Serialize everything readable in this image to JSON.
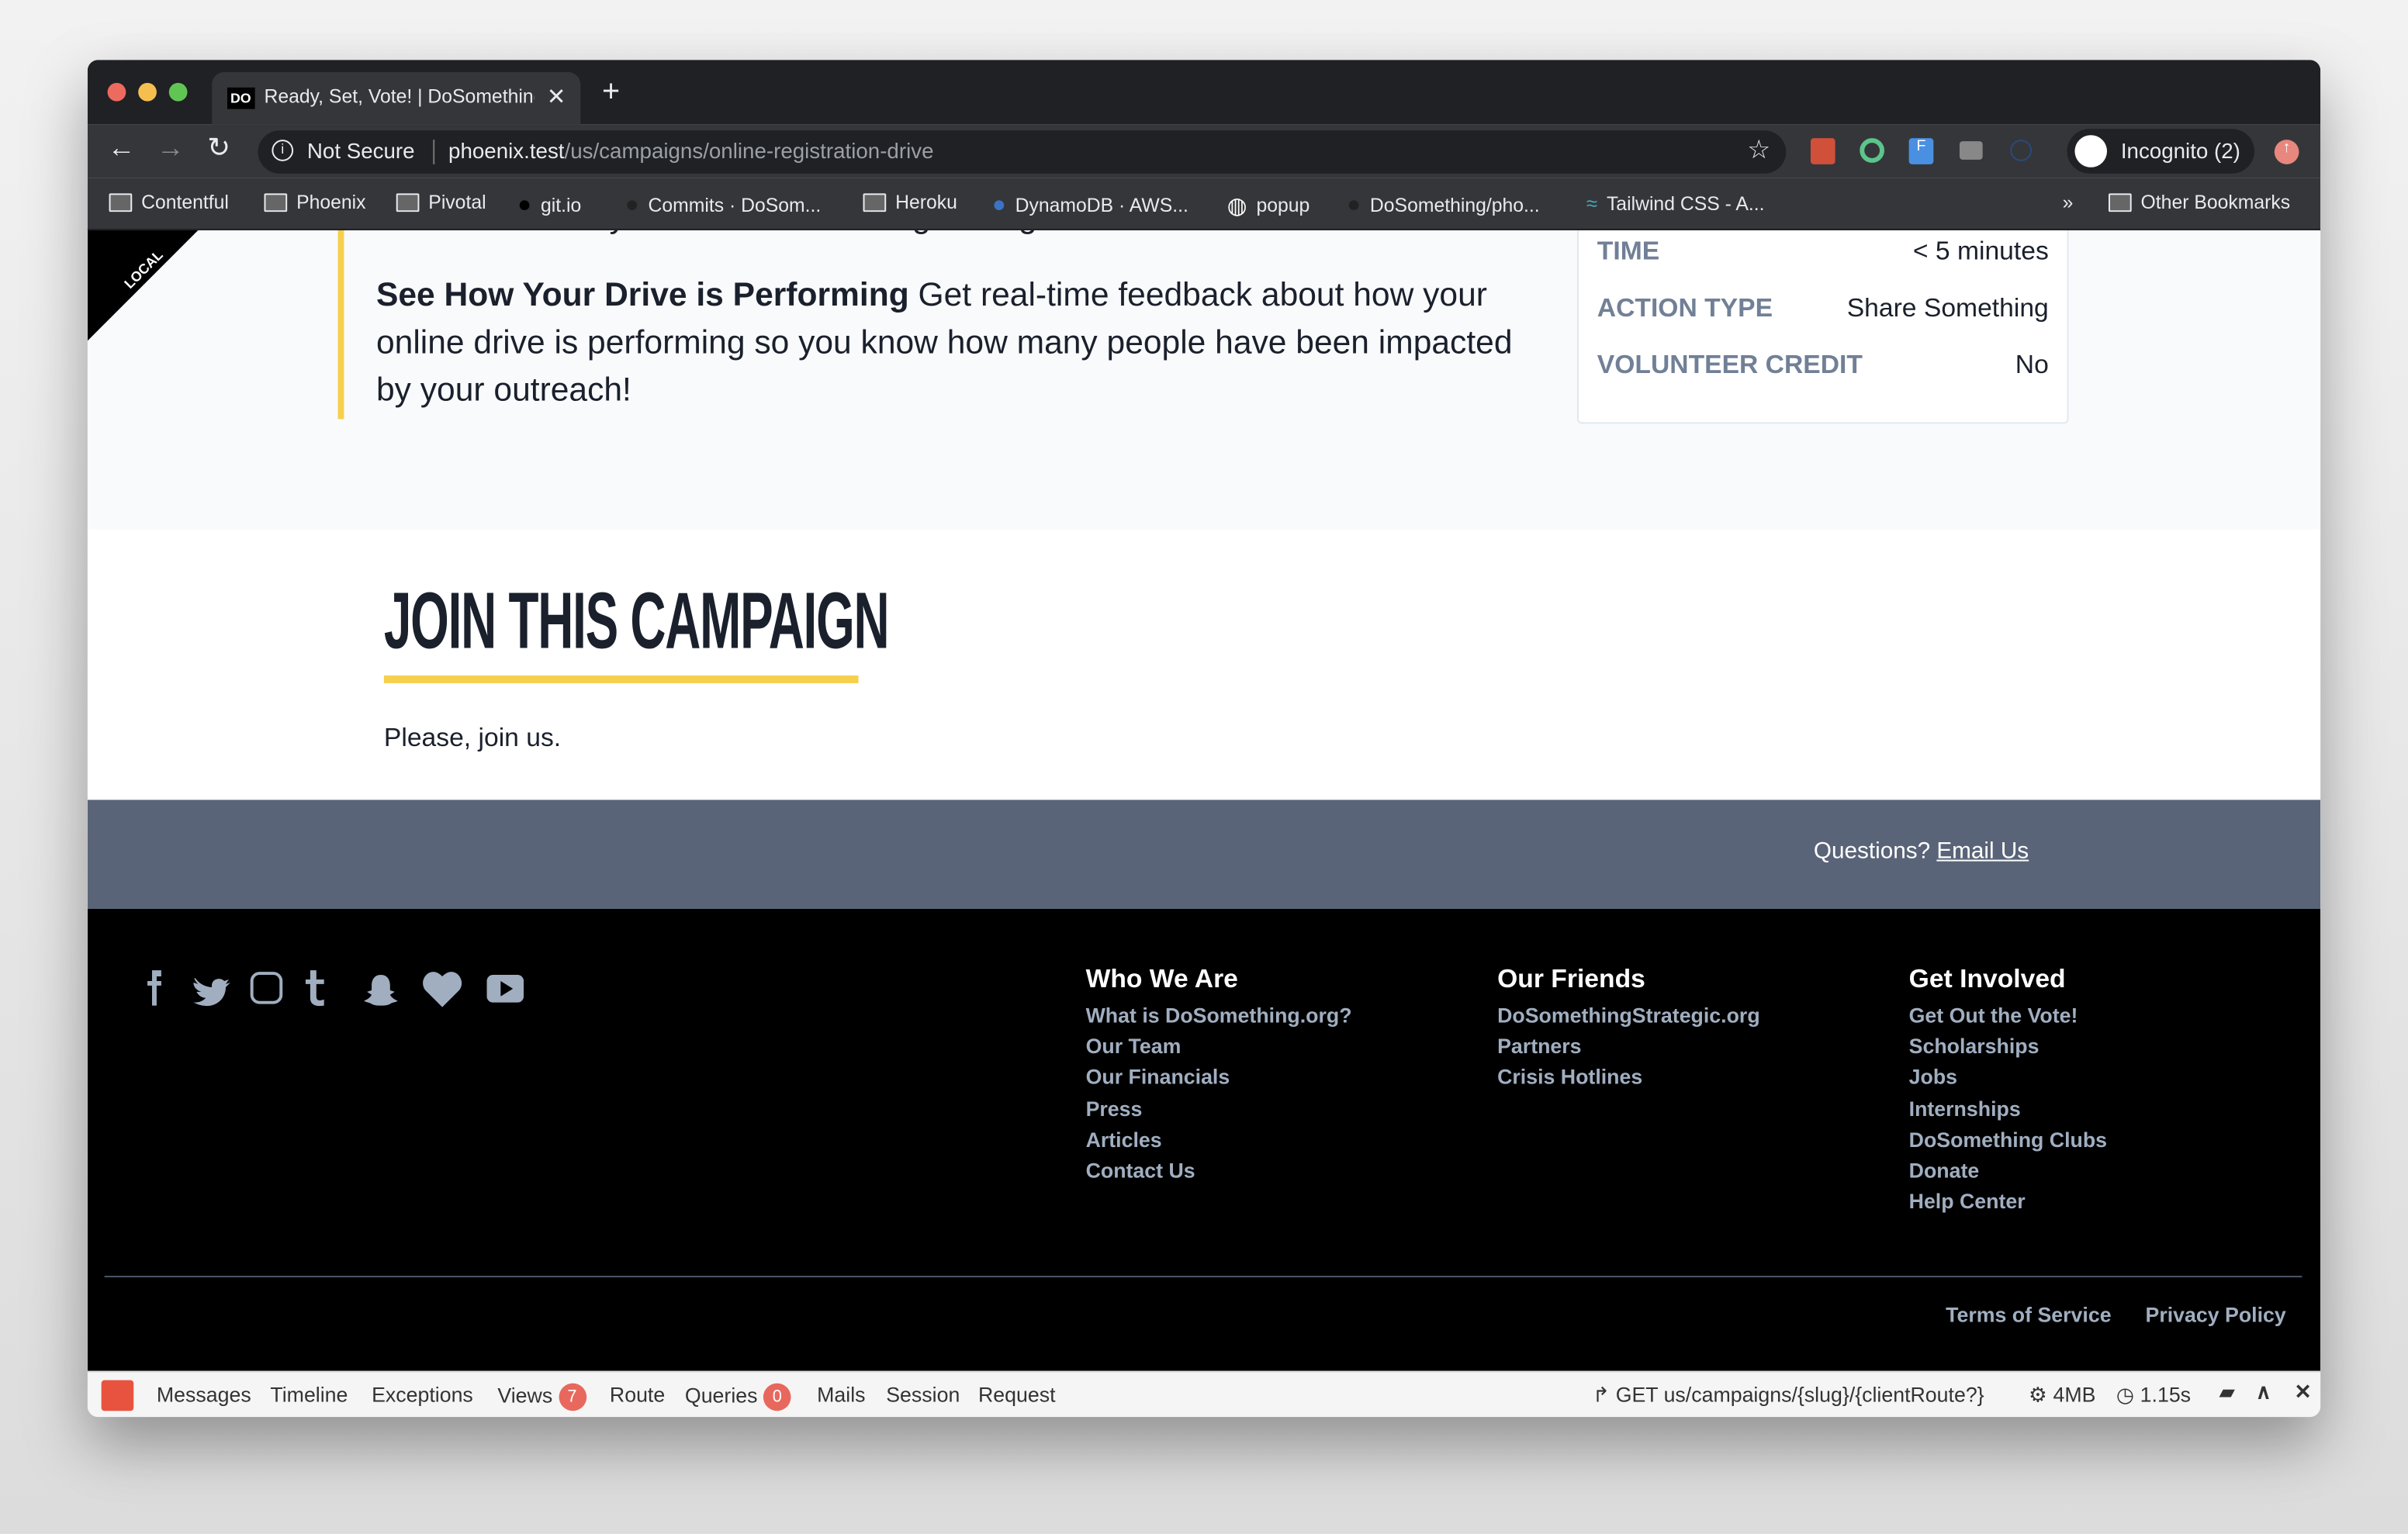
{
  "browser": {
    "tab_title": "Ready, Set, Vote! | DoSomething",
    "tab_favicon": "DO",
    "security": "Not Secure",
    "url_host": "phoenix.test",
    "url_path": "/us/campaigns/online-registration-drive",
    "profile": "Incognito (2)",
    "bookmarks": [
      "Contentful",
      "Phoenix",
      "Pivotal",
      "git.io",
      "Commits · DoSom...",
      "Heroku",
      "DynamoDB · AWS...",
      "popup",
      "DoSomething/pho...",
      "Tailwind CSS - A..."
    ],
    "more_bookmarks": "»",
    "other_bookmarks": "Other Bookmarks"
  },
  "ribbon": "LOCAL",
  "campaign": {
    "partial_line": "media to talk to your friends about registering to vote.",
    "feature_title": "See How Your Drive is Performing",
    "feature_text": " Get real-time feedback about how your online drive is performing so you know how many people have been impacted by your outreach!",
    "info": [
      {
        "label": "TIME",
        "value": "< 5 minutes"
      },
      {
        "label": "ACTION TYPE",
        "value": "Share Something"
      },
      {
        "label": "VOLUNTEER CREDIT",
        "value": "No"
      }
    ],
    "join_title": "JOIN THIS CAMPAIGN",
    "join_text": "Please, join us.",
    "accent": "#f6d04d"
  },
  "questions": {
    "text": "Questions? ",
    "link": "Email Us"
  },
  "footer": {
    "social": [
      "facebook-icon",
      "twitter-icon",
      "instagram-icon",
      "tumblr-icon",
      "snapchat-icon",
      "heart-icon",
      "youtube-icon"
    ],
    "columns": [
      {
        "title": "Who We Are",
        "links": [
          "What is DoSomething.org?",
          "Our Team",
          "Our Financials",
          "Press",
          "Articles",
          "Contact Us"
        ]
      },
      {
        "title": "Our Friends",
        "links": [
          "DoSomethingStrategic.org",
          "Partners",
          "Crisis Hotlines"
        ]
      },
      {
        "title": "Get Involved",
        "links": [
          "Get Out the Vote!",
          "Scholarships",
          "Jobs",
          "Internships",
          "DoSomething Clubs",
          "Donate",
          "Help Center"
        ]
      }
    ],
    "terms": "Terms of Service",
    "privacy": "Privacy Policy"
  },
  "debugbar": {
    "tabs": [
      "Messages",
      "Timeline",
      "Exceptions",
      "Views",
      "Route",
      "Queries",
      "Mails",
      "Session",
      "Request"
    ],
    "views_count": "7",
    "queries_count": "0",
    "route": "GET us/campaigns/{slug}/{clientRoute?}",
    "memory": "4MB",
    "time": "1.15s"
  }
}
